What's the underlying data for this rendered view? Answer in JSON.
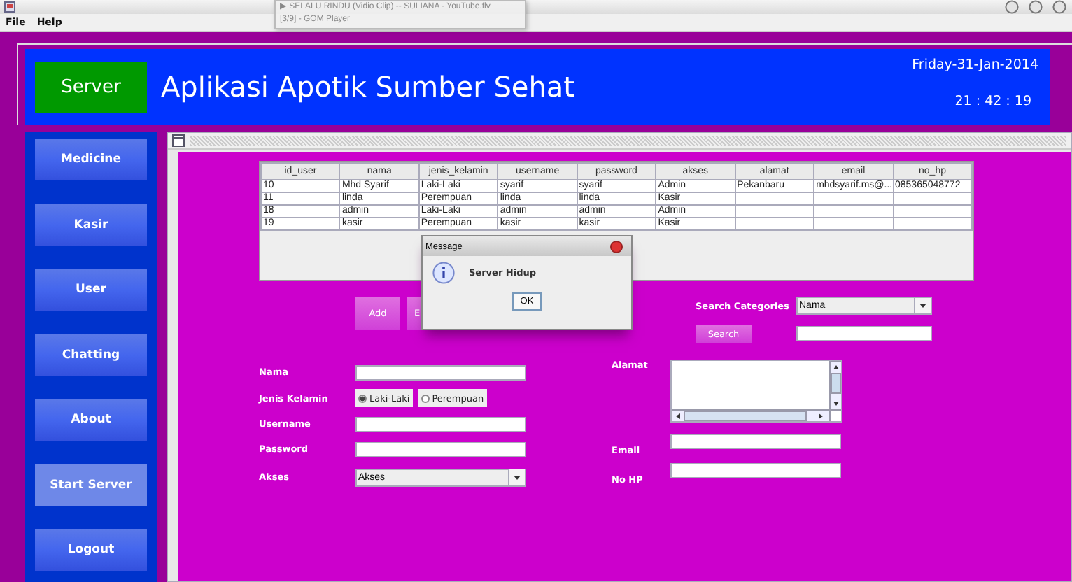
{
  "window": {
    "menu": [
      "File",
      "Help"
    ]
  },
  "tooltip": {
    "lines": [
      "▶ SELALU RINDU (Vidio Clip) -- SULIANA - YouTube.flv",
      "[3/9] - GOM Player"
    ]
  },
  "header": {
    "server_label": "Server",
    "title": "Aplikasi Apotik Sumber Sehat",
    "date": "Friday-31-Jan-2014",
    "time": "21 : 42 : 19"
  },
  "sidebar": {
    "items": [
      {
        "label": "Medicine",
        "selected": false
      },
      {
        "label": "Kasir",
        "selected": false
      },
      {
        "label": "User",
        "selected": false
      },
      {
        "label": "Chatting",
        "selected": false
      },
      {
        "label": "About",
        "selected": false
      },
      {
        "label": "Start Server",
        "selected": true
      },
      {
        "label": "Logout",
        "selected": false
      }
    ]
  },
  "table": {
    "columns": [
      "id_user",
      "nama",
      "jenis_kelamin",
      "username",
      "password",
      "akses",
      "alamat",
      "email",
      "no_hp"
    ],
    "rows": [
      [
        "10",
        "Mhd Syarif",
        "Laki-Laki",
        "syarif",
        "syarif",
        "Admin",
        "Pekanbaru",
        "mhdsyarif.ms@...",
        "085365048772"
      ],
      [
        "11",
        "linda",
        "Perempuan",
        "linda",
        "linda",
        "Kasir",
        null,
        null,
        null
      ],
      [
        "18",
        "admin",
        "Laki-Laki",
        "admin",
        "admin",
        "Admin",
        null,
        null,
        null
      ],
      [
        "19",
        "kasir",
        "Perempuan",
        "kasir",
        "kasir",
        "Kasir",
        null,
        null,
        null
      ]
    ]
  },
  "buttons": [
    {
      "label": "Add"
    },
    {
      "label": "E"
    }
  ],
  "search": {
    "label": "Search Categories",
    "category": "Nama",
    "button": "Search"
  },
  "form_left": [
    {
      "kind": "text",
      "label": "Nama"
    },
    {
      "kind": "radio",
      "label": "Jenis Kelamin",
      "options": [
        {
          "label": "Laki-Laki",
          "selected": true
        },
        {
          "label": "Perempuan",
          "selected": false
        }
      ]
    },
    {
      "kind": "text",
      "label": "Username"
    },
    {
      "kind": "text",
      "label": "Password"
    },
    {
      "kind": "combo",
      "label": "Akses",
      "value": "Akses"
    }
  ],
  "form_right": [
    {
      "kind": "textarea",
      "label": "Alamat"
    },
    {
      "kind": "text",
      "label": "Email"
    },
    {
      "kind": "text",
      "label": "No HP"
    }
  ],
  "dialog": {
    "title": "Message",
    "message": "Server Hidup",
    "button": "OK"
  }
}
